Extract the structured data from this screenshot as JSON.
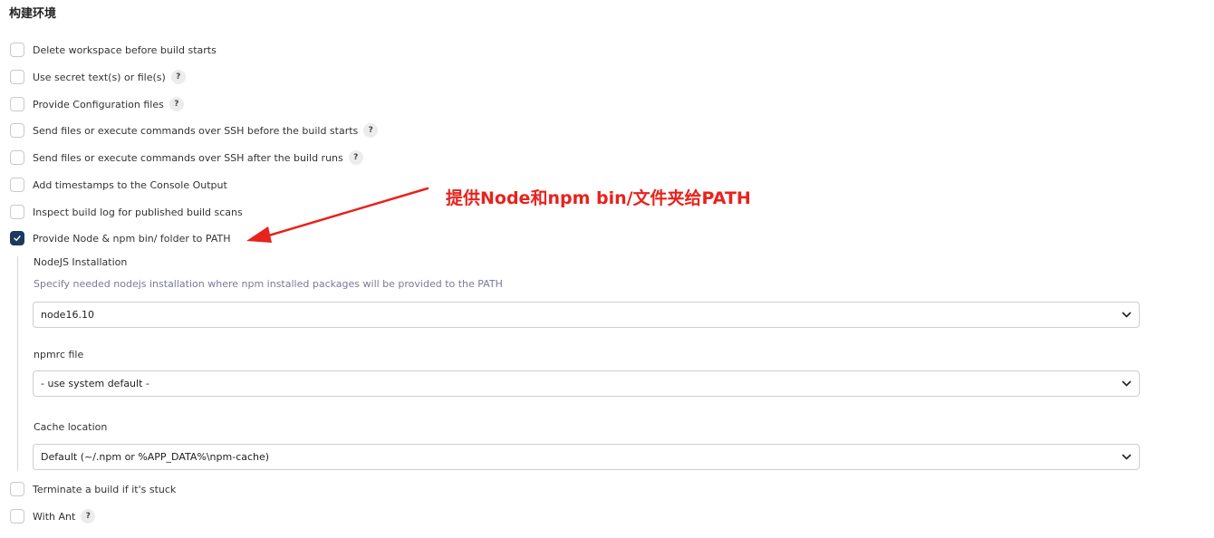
{
  "section": {
    "title": "构建环境"
  },
  "options": [
    {
      "label": "Delete workspace before build starts",
      "checked": false,
      "help": false
    },
    {
      "label": "Use secret text(s) or file(s)",
      "checked": false,
      "help": true
    },
    {
      "label": "Provide Configuration files",
      "checked": false,
      "help": true
    },
    {
      "label": "Send files or execute commands over SSH before the build starts",
      "checked": false,
      "help": true
    },
    {
      "label": "Send files or execute commands over SSH after the build runs",
      "checked": false,
      "help": true
    },
    {
      "label": "Add timestamps to the Console Output",
      "checked": false,
      "help": false
    },
    {
      "label": "Inspect build log for published build scans",
      "checked": false,
      "help": false
    },
    {
      "label": "Provide Node & npm bin/ folder to PATH",
      "checked": true,
      "help": false
    },
    {
      "label": "Terminate a build if it's stuck",
      "checked": false,
      "help": false
    },
    {
      "label": "With Ant",
      "checked": false,
      "help": true
    }
  ],
  "help_glyph": "?",
  "node_config": {
    "installation_label": "NodeJS Installation",
    "installation_desc": "Specify needed nodejs installation where npm installed packages will be provided to the PATH",
    "installation_value": "node16.10",
    "npmrc_label": "npmrc file",
    "npmrc_value": "- use system default -",
    "cache_label": "Cache location",
    "cache_value": "Default (~/.npm or %APP_DATA%\\npm-cache)"
  },
  "annotation": {
    "text": "提供Node和npm bin/文件夹给PATH",
    "color": "#e8221c"
  },
  "colors": {
    "checked": "#1d3a5c",
    "desc": "#7a7a9a"
  }
}
